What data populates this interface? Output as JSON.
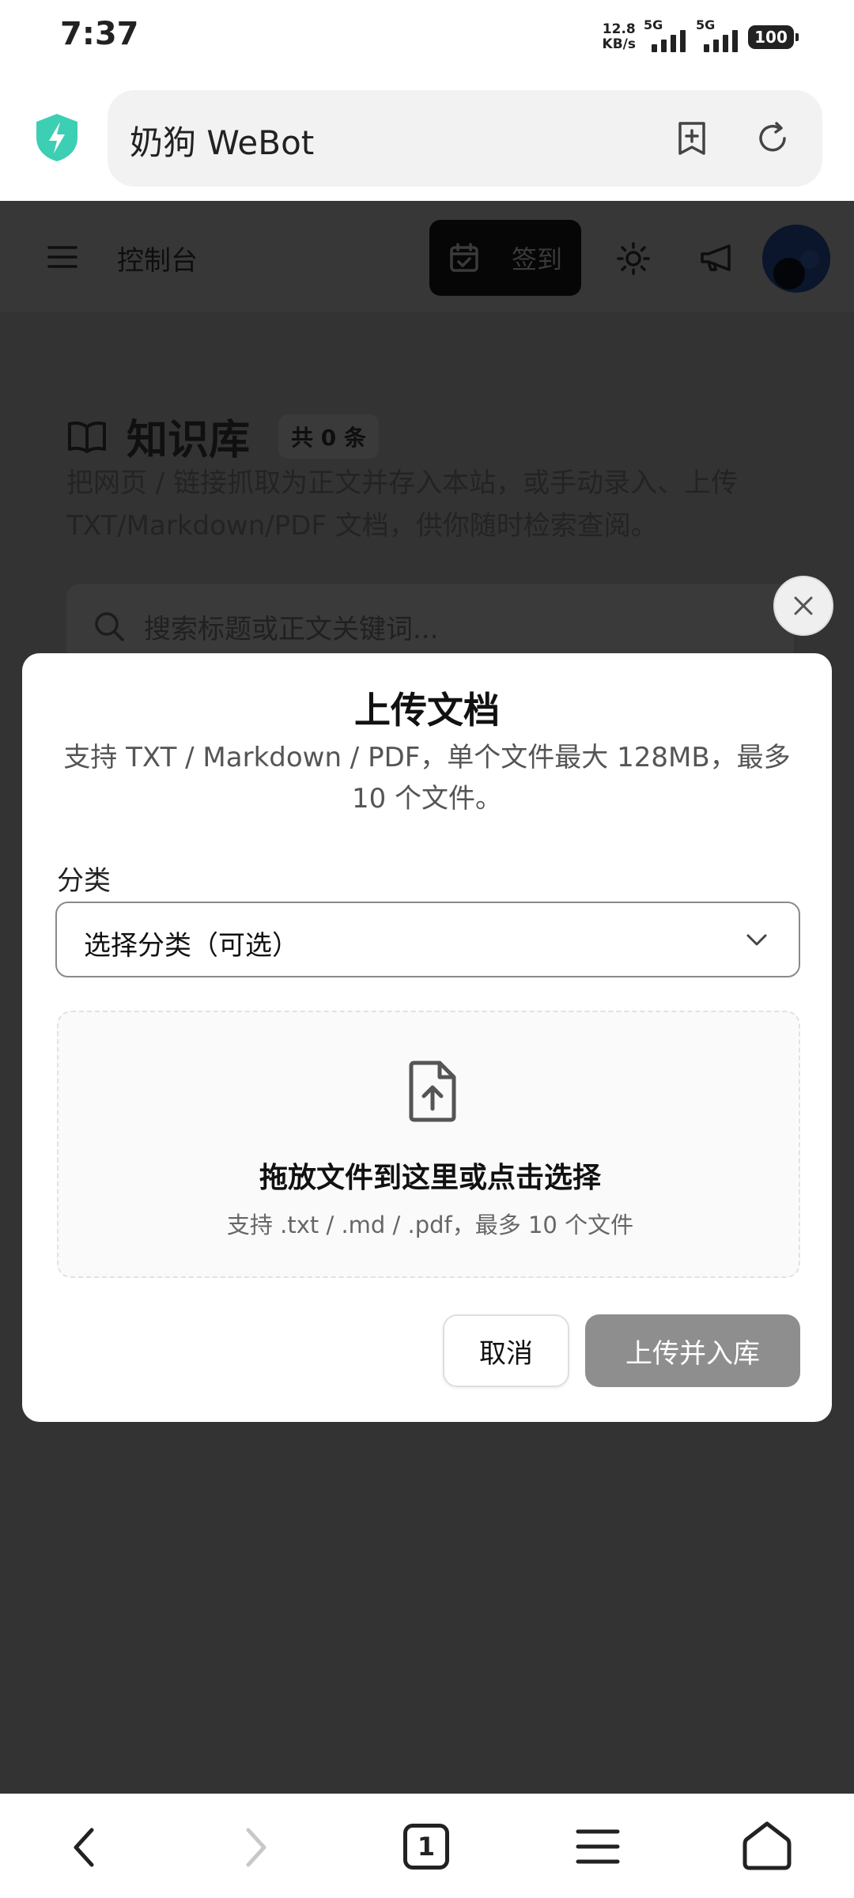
{
  "status_bar": {
    "time": "7:37",
    "net_speed_value": "12.8",
    "net_speed_unit": "KB/s",
    "signal1_tag": "5G",
    "signal2_tag": "5G",
    "battery": "100"
  },
  "browser": {
    "url_title": "奶狗 WeBot"
  },
  "app_header": {
    "title": "控制台",
    "checkin_label": "签到"
  },
  "knowledge_base": {
    "title": "知识库",
    "count": "共 0 条",
    "description": "把网页 / 链接抓取为正文并存入本站，或手动录入、上传 TXT/Markdown/PDF 文档，供你随时检索查阅。",
    "search_placeholder": "搜索标题或正文关键词..."
  },
  "modal": {
    "title": "上传文档",
    "description": "支持 TXT / Markdown / PDF，单个文件最大 128MB，最多 10 个文件。",
    "category_label": "分类",
    "category_value": "选择分类（可选）",
    "dropzone_title": "拖放文件到这里或点击选择",
    "dropzone_sub": "支持 .txt / .md / .pdf，最多 10 个文件",
    "cancel_label": "取消",
    "upload_label": "上传并入库"
  },
  "bottom_nav": {
    "tab_count": "1"
  },
  "colors": {
    "overlay": "#333333",
    "accent_shield": "#3ccfb4",
    "upload_button_disabled": "#8e8e8e"
  }
}
